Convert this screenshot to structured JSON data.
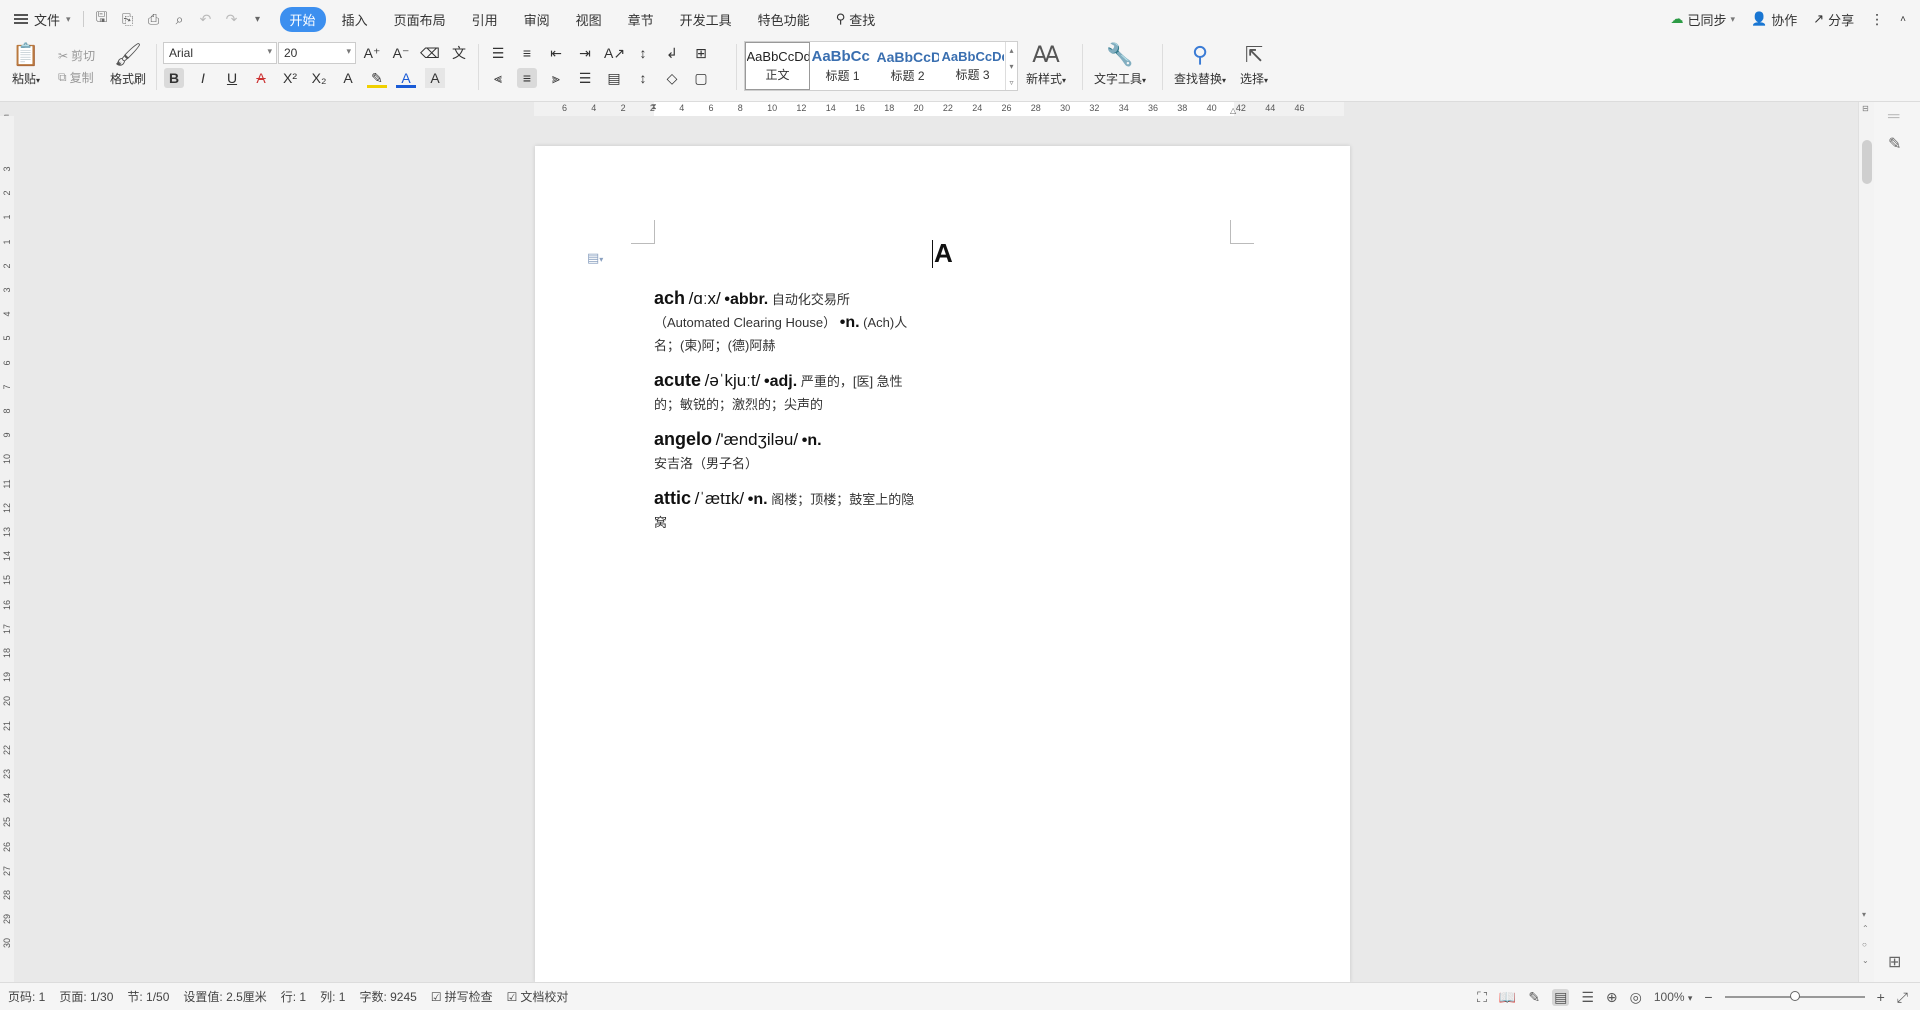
{
  "menubar": {
    "file_label": "文件",
    "tabs": [
      "开始",
      "插入",
      "页面布局",
      "引用",
      "审阅",
      "视图",
      "章节",
      "开发工具",
      "特色功能"
    ],
    "active_tab": "开始",
    "search_label": "查找",
    "sync_label": "已同步",
    "collab_label": "协作",
    "share_label": "分享"
  },
  "ribbon": {
    "paste_label": "粘贴",
    "cut_label": "剪切",
    "copy_label": "复制",
    "format_painter_label": "格式刷",
    "font_name": "Arial",
    "font_size": "20",
    "styles": [
      {
        "preview": "AaBbCcDd",
        "name": "正文"
      },
      {
        "preview": "AaBbCc",
        "name": "标题 1"
      },
      {
        "preview": "AaBbCcD",
        "name": "标题 2"
      },
      {
        "preview": "AaBbCcDd",
        "name": "标题 3"
      }
    ],
    "new_style_label": "新样式",
    "text_tools_label": "文字工具",
    "find_replace_label": "查找替换",
    "select_label": "选择"
  },
  "ruler": {
    "h_ticks": [
      "6",
      "4",
      "2",
      "2",
      "4",
      "6",
      "8",
      "10",
      "12",
      "14",
      "16",
      "18",
      "20",
      "22",
      "24",
      "26",
      "28",
      "30",
      "32",
      "34",
      "36",
      "38",
      "40",
      "42",
      "44",
      "46"
    ],
    "v_ticks": [
      "3",
      "2",
      "1",
      "1",
      "2",
      "3",
      "4",
      "5",
      "6",
      "7",
      "8",
      "9",
      "10",
      "11",
      "12",
      "13",
      "14",
      "15",
      "16",
      "17",
      "18",
      "19",
      "20",
      "21",
      "22",
      "23",
      "24",
      "25",
      "26",
      "27",
      "28",
      "29",
      "30"
    ]
  },
  "document": {
    "title": "A",
    "entries": [
      {
        "word": "ach",
        "phonetic": "/ɑːx/",
        "pos1": "•abbr.",
        "def1": "自动化交易所（Automated Clearing House）",
        "pos2": "•n.",
        "def2": "(Ach)人名；(柬)阿；(德)阿赫"
      },
      {
        "word": "acute",
        "phonetic": "/əˈkjuːt/",
        "pos1": "•adj.",
        "def1": "严重的，[医] 急性的；敏锐的；激烈的；尖声的",
        "pos2": "",
        "def2": ""
      },
      {
        "word": "angelo",
        "phonetic": "/'ændʒiləu/",
        "pos1": "•n.",
        "def1": "安吉洛（男子名）",
        "pos2": "",
        "def2": ""
      },
      {
        "word": "attic",
        "phonetic": "/ˈætɪk/",
        "pos1": "•n.",
        "def1": "阁楼；顶楼；鼓室上的隐窝",
        "pos2": "",
        "def2": ""
      }
    ]
  },
  "statusbar": {
    "page_code": "页码: 1",
    "page": "页面: 1/30",
    "section": "节: 1/50",
    "setting": "设置值: 2.5厘米",
    "row": "行: 1",
    "col": "列: 1",
    "word_count": "字数: 9245",
    "spell_check": "拼写检查",
    "doc_check": "文档校对",
    "zoom": "100%"
  },
  "zoom_value": 1.0
}
